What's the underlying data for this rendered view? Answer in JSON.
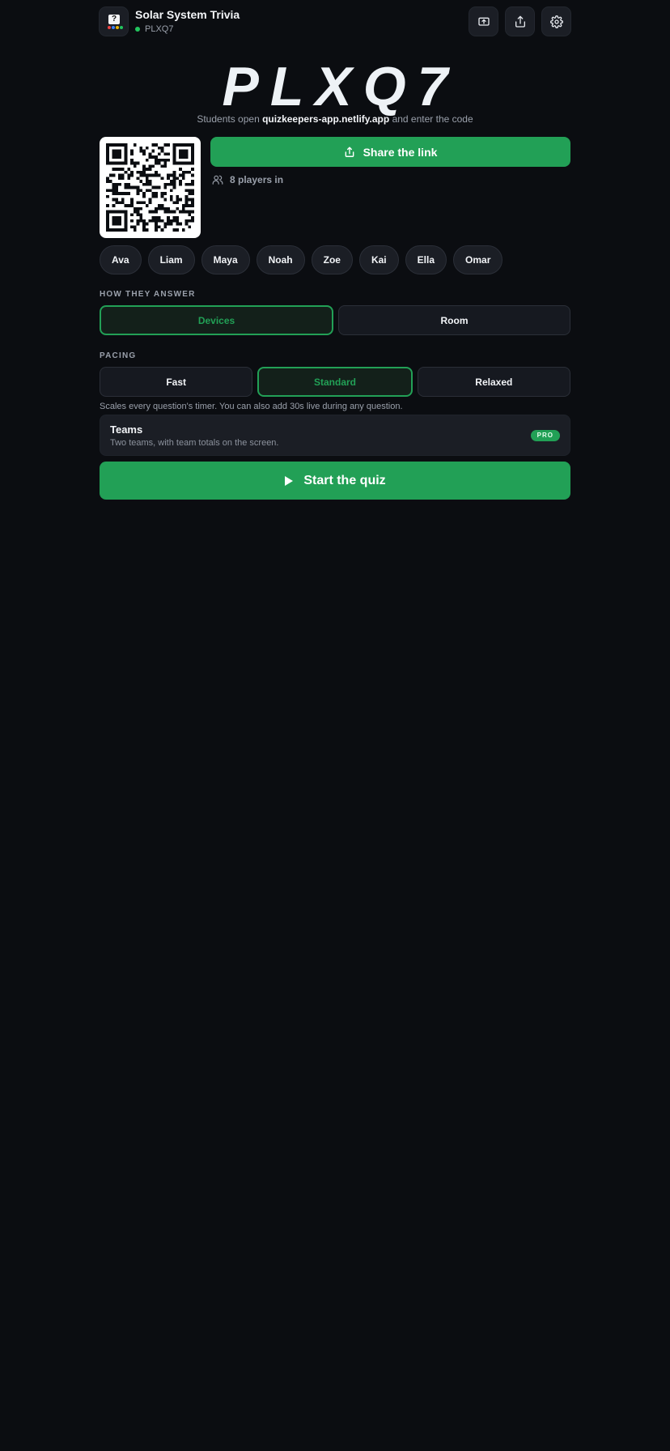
{
  "header": {
    "title": "Solar System Trivia",
    "room_code": "PLXQ7"
  },
  "join": {
    "code": "PLXQ7",
    "instructions_prefix": "Students open ",
    "site": "quizkeepers-app.netlify.app",
    "instructions_suffix": " and enter the code",
    "share_label": "Share the link",
    "players_label": "8 players in"
  },
  "players": [
    "Ava",
    "Liam",
    "Maya",
    "Noah",
    "Zoe",
    "Kai",
    "Ella",
    "Omar"
  ],
  "answer_mode": {
    "label": "HOW THEY ANSWER",
    "options": [
      "Devices",
      "Room"
    ],
    "selected": "Devices"
  },
  "pacing": {
    "label": "PACING",
    "options": [
      "Fast",
      "Standard",
      "Relaxed"
    ],
    "selected": "Standard",
    "hint": "Scales every question's timer. You can also add 30s live during any question."
  },
  "teams": {
    "title": "Teams",
    "description": "Two teams, with team totals on the screen.",
    "badge": "PRO"
  },
  "start_label": "Start the quiz",
  "colors": {
    "accent": "#22a056",
    "background": "#0b0d11",
    "card": "#1b1e25"
  },
  "icons": {
    "header_buttons": [
      "present-screen-icon",
      "share-icon",
      "gear-icon"
    ]
  }
}
